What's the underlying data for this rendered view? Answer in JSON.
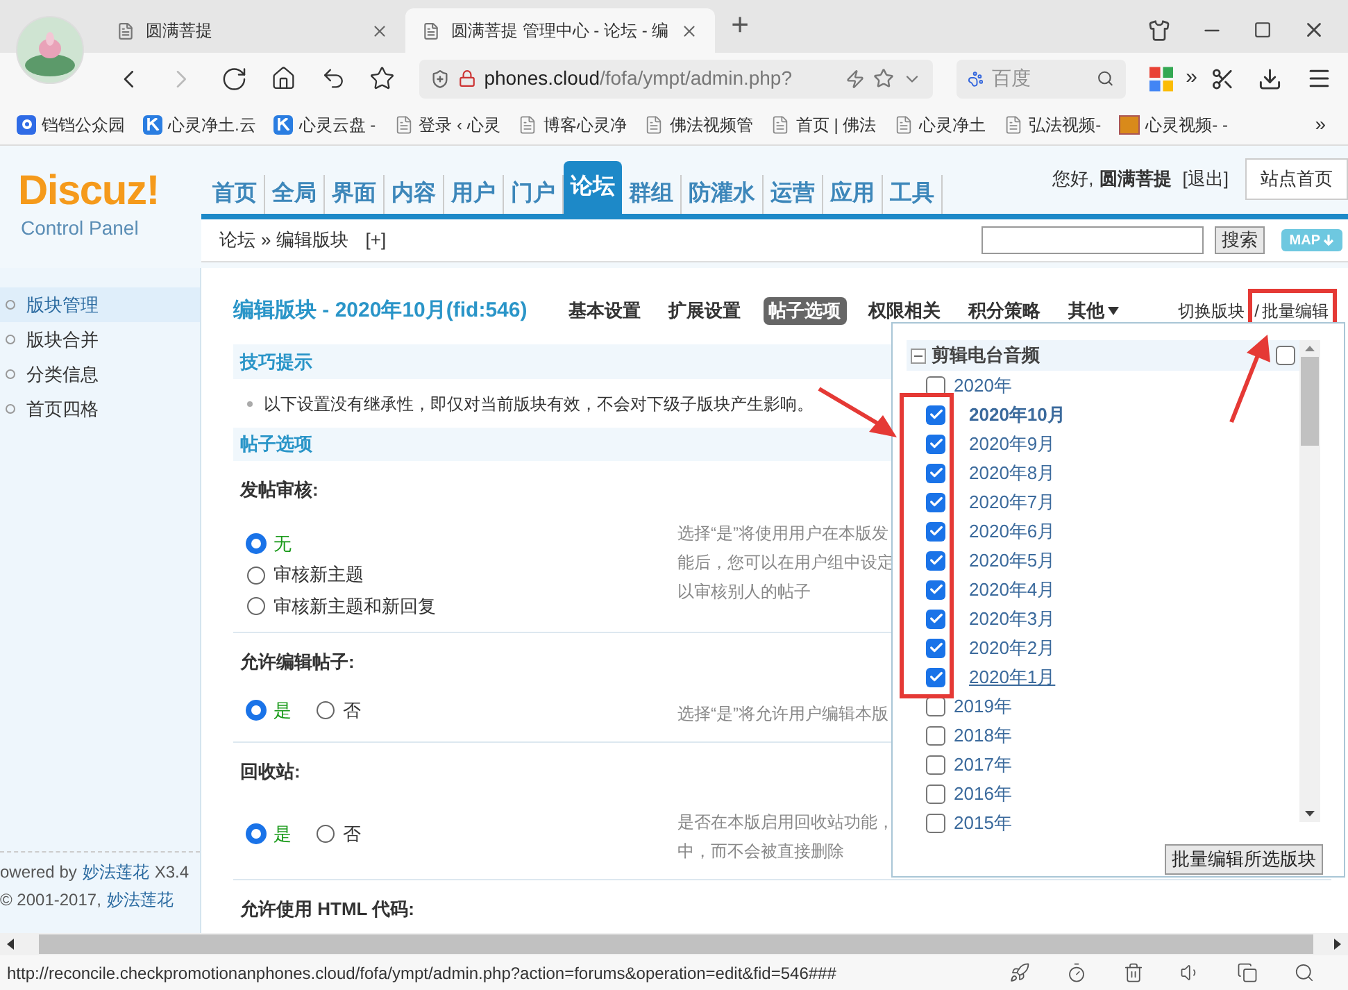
{
  "browser": {
    "tabs": [
      {
        "title": "圆满菩提",
        "selected": false
      },
      {
        "title": "圆满菩提 管理中心 - 论坛 - 编",
        "selected": true
      }
    ],
    "new_tab": "+",
    "address": {
      "host": "phones.cloud",
      "path": "/fofa/ympt/admin.php?"
    },
    "search": {
      "placeholder": "百度"
    },
    "more": "»",
    "bookmarks": [
      {
        "label": "铛铛公众园",
        "kind": "q"
      },
      {
        "label": "心灵净土.云",
        "kind": "k"
      },
      {
        "label": "心灵云盘 -",
        "kind": "k"
      },
      {
        "label": "登录 ‹ 心灵",
        "kind": "page"
      },
      {
        "label": "博客心灵净",
        "kind": "page"
      },
      {
        "label": "佛法视频管",
        "kind": "page"
      },
      {
        "label": "首页 | 佛法",
        "kind": "page"
      },
      {
        "label": "心灵净土",
        "kind": "page"
      },
      {
        "label": "弘法视频-",
        "kind": "page"
      },
      {
        "label": "心灵视频- -",
        "kind": "image"
      }
    ],
    "bookmarks_more": "»"
  },
  "header": {
    "logo": "Discuz!",
    "logo_sub": "Control Panel",
    "nav": [
      {
        "label": "首页",
        "selected": false
      },
      {
        "label": "全局",
        "selected": false
      },
      {
        "label": "界面",
        "selected": false
      },
      {
        "label": "内容",
        "selected": false
      },
      {
        "label": "用户",
        "selected": false
      },
      {
        "label": "门户",
        "selected": false
      },
      {
        "label": "论坛",
        "selected": true
      },
      {
        "label": "群组",
        "selected": false
      },
      {
        "label": "防灌水",
        "selected": false
      },
      {
        "label": "运营",
        "selected": false
      },
      {
        "label": "应用",
        "selected": false
      },
      {
        "label": "工具",
        "selected": false
      }
    ],
    "greeting": "您好,",
    "user": "圆满菩提",
    "logout": "[退出]",
    "site_home": "站点首页"
  },
  "breadcrumb": {
    "items": [
      "论坛",
      "»",
      "编辑版块"
    ],
    "add": "[+]",
    "search_button": "搜索",
    "map": "MAP"
  },
  "sidebar": {
    "items": [
      {
        "label": "版块管理",
        "selected": true
      },
      {
        "label": "版块合并",
        "selected": false
      },
      {
        "label": "分类信息",
        "selected": false
      },
      {
        "label": "首页四格",
        "selected": false
      }
    ],
    "footer": [
      {
        "text": "owered by",
        "link": "妙法莲花",
        "suffix": "X3.4"
      },
      {
        "text": "© 2001-2017,",
        "link": "妙法莲花"
      }
    ]
  },
  "page": {
    "title": "编辑版块 - 2020年10月(fid:546)",
    "tabs": [
      {
        "label": "基本设置",
        "selected": false
      },
      {
        "label": "扩展设置",
        "selected": false
      },
      {
        "label": "帖子选项",
        "selected": true
      },
      {
        "label": "权限相关",
        "selected": false
      },
      {
        "label": "积分策略",
        "selected": false
      },
      {
        "label": "其他",
        "selected": false
      }
    ],
    "switch_forum": "切换版块",
    "separator": "/",
    "batch_edit": "批量编辑",
    "tips": {
      "title": "技巧提示",
      "text": "以下设置没有继承性，即仅对当前版块有效，不会对下级子版块产生影响。"
    },
    "section": "帖子选项",
    "settings": [
      {
        "label": "发帖审核:",
        "kind": "stacked",
        "options": [
          {
            "label": "无",
            "selected": true
          },
          {
            "label": "审核新主题",
            "selected": false
          },
          {
            "label": "审核新主题和新回复",
            "selected": false
          }
        ],
        "description": [
          "选择“是”将使用用户在本版发",
          "能后，您可以在用户组中设定",
          "以审核别人的帖子"
        ]
      },
      {
        "label": "允许编辑帖子:",
        "kind": "inline",
        "options": [
          {
            "label": "是",
            "selected": true
          },
          {
            "label": "否",
            "selected": false
          }
        ],
        "description": [
          "选择“是”将允许用户编辑本版"
        ]
      },
      {
        "label": "回收站:",
        "kind": "inline",
        "options": [
          {
            "label": "是",
            "selected": true
          },
          {
            "label": "否",
            "selected": false
          }
        ],
        "description": [
          "是否在本版启用回收站功能，",
          "中，而不会被直接删除"
        ]
      },
      {
        "label": "允许使用 HTML 代码:",
        "kind": "label_only"
      }
    ]
  },
  "popup": {
    "group": "剪辑电台音频",
    "group_checked": false,
    "tree": [
      {
        "label": "2020年",
        "checked": false,
        "children": [
          {
            "label": "2020年10月",
            "checked": true,
            "current": true,
            "hovered": false
          },
          {
            "label": "2020年9月",
            "checked": true,
            "current": false,
            "hovered": false
          },
          {
            "label": "2020年8月",
            "checked": true,
            "current": false,
            "hovered": false
          },
          {
            "label": "2020年7月",
            "checked": true,
            "current": false,
            "hovered": false
          },
          {
            "label": "2020年6月",
            "checked": true,
            "current": false,
            "hovered": false
          },
          {
            "label": "2020年5月",
            "checked": true,
            "current": false,
            "hovered": false
          },
          {
            "label": "2020年4月",
            "checked": true,
            "current": false,
            "hovered": false
          },
          {
            "label": "2020年3月",
            "checked": true,
            "current": false,
            "hovered": false
          },
          {
            "label": "2020年2月",
            "checked": true,
            "current": false,
            "hovered": false
          },
          {
            "label": "2020年1月",
            "checked": true,
            "current": false,
            "hovered": true
          }
        ]
      },
      {
        "label": "2019年",
        "checked": false
      },
      {
        "label": "2018年",
        "checked": false
      },
      {
        "label": "2017年",
        "checked": false
      },
      {
        "label": "2016年",
        "checked": false
      },
      {
        "label": "2015年",
        "checked": false
      }
    ],
    "button": "批量编辑所选版块"
  },
  "status_bar": {
    "url": "http://reconcile.checkpromotionanphones.cloud/fofa/ympt/admin.php?action=forums&operation=edit&fid=546###"
  }
}
